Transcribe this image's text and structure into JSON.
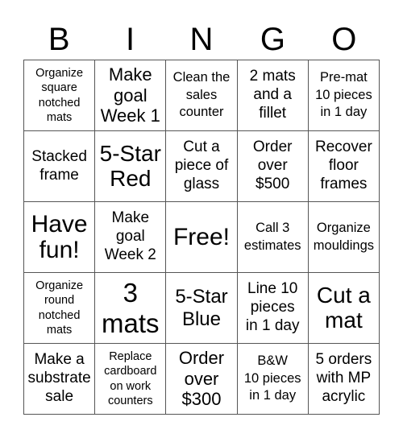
{
  "header": [
    "B",
    "I",
    "N",
    "G",
    "O"
  ],
  "cells": [
    [
      "Organize\nsquare\nnotched\nmats",
      "Make\ngoal\nWeek 1",
      "Clean the\nsales\ncounter",
      "2 mats\nand a\nfillet",
      "Pre-mat\n10 pieces\nin 1 day"
    ],
    [
      "Stacked\nframe",
      "5-Star\nRed",
      "Cut a\npiece of\nglass",
      "Order\nover\n$500",
      "Recover\nfloor\nframes"
    ],
    [
      "Have\nfun!",
      "Make\ngoal\nWeek 2",
      "Free!",
      "Call 3\nestimates",
      "Organize\nmouldings"
    ],
    [
      "Organize\nround\nnotched\nmats",
      "3\nmats",
      "5-Star\nBlue",
      "Line 10\npieces\nin 1 day",
      "Cut a\nmat"
    ],
    [
      "Make a\nsubstrate\nsale",
      "Replace\ncardboard\non work\ncounters",
      "Order\nover\n$300",
      "B&W\n10 pieces\nin 1 day",
      "5 orders\nwith MP\nacrylic"
    ]
  ]
}
